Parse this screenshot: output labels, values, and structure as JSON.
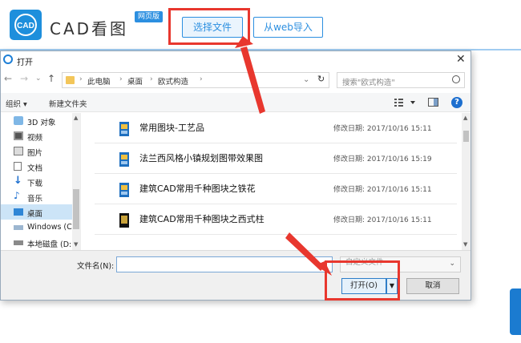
{
  "web": {
    "brand": "CAD看图",
    "badge": "网页版",
    "select_file": "选择文件",
    "import_web": "从web导入",
    "logo_text": "CAD"
  },
  "dialog": {
    "title": "打开",
    "close": "✕",
    "nav": {
      "back": "←",
      "forward": "→",
      "dropdown": "⌄",
      "up": "↑"
    },
    "breadcrumb": [
      "此电脑",
      "桌面",
      "欧式构造"
    ],
    "refresh": "↻",
    "search_placeholder": "搜索\"欧式构造\"",
    "toolbar": {
      "organize": "组织 ▾",
      "new_folder": "新建文件夹"
    },
    "sidebar": [
      {
        "label": "3D 对象",
        "icon": "3d-objects-icon"
      },
      {
        "label": "视频",
        "icon": "video-icon"
      },
      {
        "label": "图片",
        "icon": "pictures-icon"
      },
      {
        "label": "文档",
        "icon": "documents-icon"
      },
      {
        "label": "下载",
        "icon": "download-icon"
      },
      {
        "label": "音乐",
        "icon": "music-icon"
      },
      {
        "label": "桌面",
        "icon": "desktop-icon",
        "active": true
      },
      {
        "label": "Windows (C",
        "icon": "drive-icon"
      },
      {
        "label": "本地磁盘 (D:",
        "icon": "disk-icon"
      }
    ],
    "files": [
      {
        "name": "常用图块-工艺品",
        "meta": "修改日期: 2017/10/16 15:11"
      },
      {
        "name": "法兰西风格小镇规划图带效果图",
        "meta": "修改日期: 2017/10/16 15:19"
      },
      {
        "name": "建筑CAD常用千种图块之铁花",
        "meta": "修改日期: 2017/10/16 15:11"
      },
      {
        "name": "建筑CAD常用千种图块之西式柱",
        "meta": "修改日期: 2017/10/16 15:11"
      }
    ],
    "file_name_label": "文件名(N):",
    "file_name_value": "",
    "file_type": "自定义文件",
    "open_button": "打开(O)",
    "cancel_button": "取消"
  },
  "colors": {
    "accent": "#2c8fe0",
    "highlight": "#e8372e"
  }
}
